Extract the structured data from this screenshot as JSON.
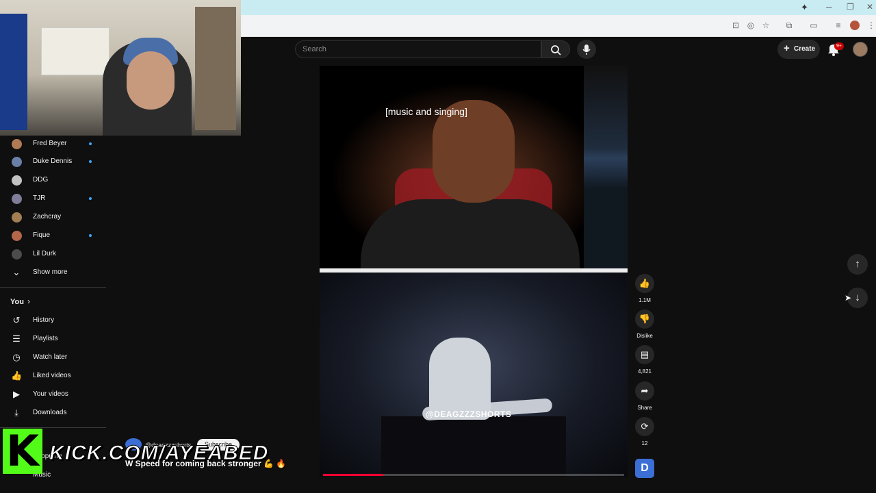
{
  "browser": {
    "window_controls": {
      "minimize": "─",
      "maximize": "❐",
      "close": "✕"
    }
  },
  "search": {
    "placeholder": "Search"
  },
  "header": {
    "create_label": "Create",
    "notifications_badge": "9+"
  },
  "sidebar": {
    "subscriptions": [
      {
        "name": "Fred Beyer",
        "new": true
      },
      {
        "name": "Duke Dennis",
        "new": true
      },
      {
        "name": "DDG",
        "new": false
      },
      {
        "name": "TJR",
        "new": true
      },
      {
        "name": "Zachcray",
        "new": false
      },
      {
        "name": "Fique",
        "new": true
      },
      {
        "name": "Lil Durk",
        "new": false
      }
    ],
    "show_more": "Show more",
    "you_section": {
      "title": "You",
      "chevron": "›"
    },
    "you_items": [
      {
        "label": "History",
        "icon": "history-icon"
      },
      {
        "label": "Playlists",
        "icon": "playlists-icon"
      },
      {
        "label": "Watch later",
        "icon": "watch-later-icon"
      },
      {
        "label": "Liked videos",
        "icon": "liked-videos-icon"
      },
      {
        "label": "Your videos",
        "icon": "your-videos-icon"
      },
      {
        "label": "Downloads",
        "icon": "downloads-icon"
      }
    ],
    "explore_items": [
      {
        "label": "Shopping"
      },
      {
        "label": "Music"
      }
    ]
  },
  "video": {
    "caption": "[music and singing]",
    "watermark": "@DEAGZZZSHORTS",
    "progress_percent": 20
  },
  "short": {
    "channel_handle": "@deagzzzshorts",
    "subscribe_label": "Subscribe",
    "title": "W Speed for coming back stronger 💪 🔥"
  },
  "actions": {
    "likes": "1.1M",
    "dislike_label": "Dislike",
    "comments": "4,821",
    "share_label": "Share",
    "remix_count": "12",
    "channel_icon_letter": "D"
  },
  "overlay": {
    "kick_logo_letter": "K",
    "kick_url": "KICK.COM/AYEABED"
  },
  "colors": {
    "accent_red": "#ff0033",
    "kick_green": "#53fc18",
    "badge_red": "#cc0000",
    "link_blue": "#3ea6ff"
  }
}
